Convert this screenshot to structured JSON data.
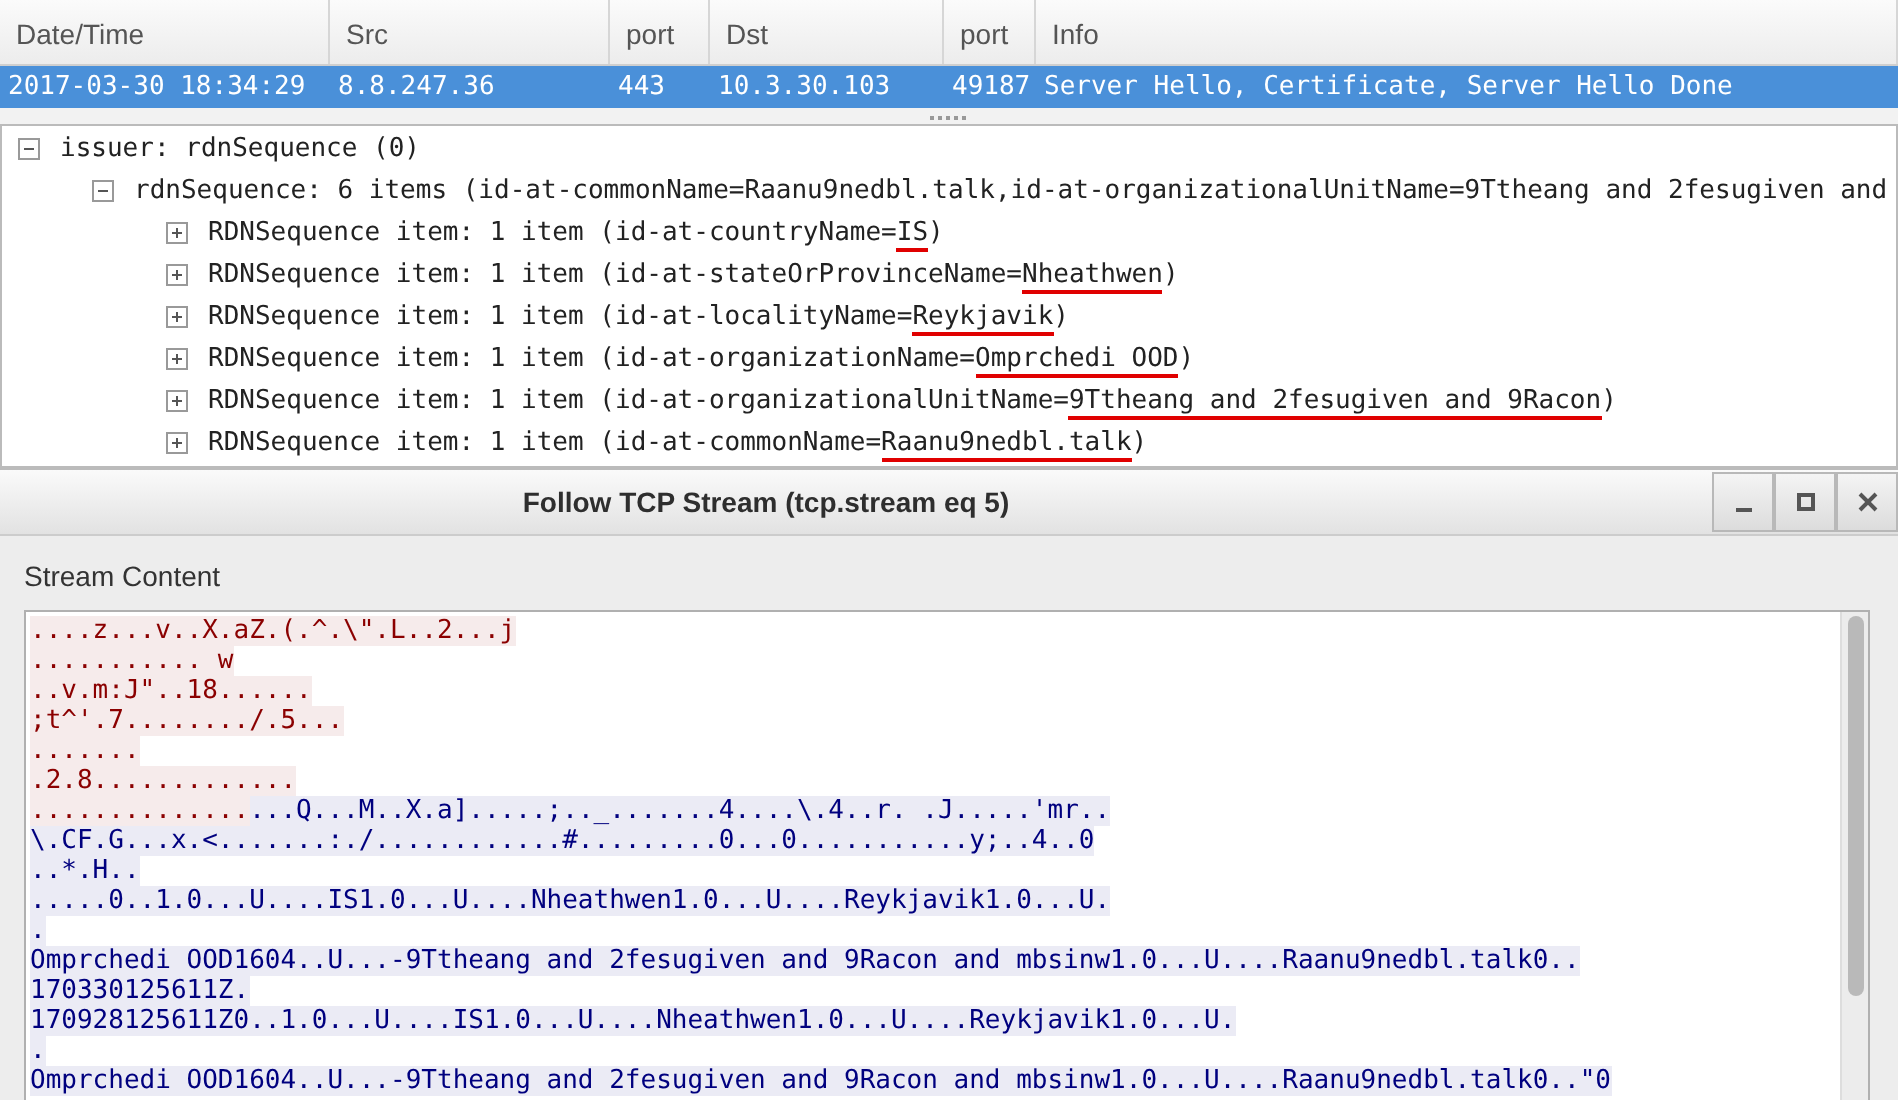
{
  "packet_list": {
    "columns": [
      "Date/Time",
      "Src",
      "port",
      "Dst",
      "port",
      "Info"
    ],
    "rows": [
      {
        "selected": true,
        "cells": [
          "2017-03-30 18:34:29",
          "8.8.247.36",
          "443",
          "10.3.30.103",
          "49187",
          "Server Hello, Certificate, Server Hello Done"
        ]
      }
    ]
  },
  "details": {
    "tree": [
      {
        "label": "issuer: rdnSequence (0)",
        "expanded": true,
        "children": [
          {
            "label": "rdnSequence: 6 items (id-at-commonName=Raanu9nedbl.talk,id-at-organizationalUnitName=9Ttheang and 2fesugiven and",
            "expanded": true,
            "children": [
              {
                "label": "RDNSequence item: 1 item (id-at-countryName=",
                "value": "IS",
                "label_end": ")",
                "underlined": true,
                "expanded": false
              },
              {
                "label": "RDNSequence item: 1 item (id-at-stateOrProvinceName=",
                "value": "Nheathwen",
                "label_end": ")",
                "underlined": true,
                "expanded": false
              },
              {
                "label": "RDNSequence item: 1 item (id-at-localityName=",
                "value": "Reykjavik",
                "label_end": ")",
                "underlined": true,
                "expanded": false
              },
              {
                "label": "RDNSequence item: 1 item (id-at-organizationName=",
                "value": "Omprchedi OOD",
                "label_end": ")",
                "underlined": true,
                "expanded": false
              },
              {
                "label": "RDNSequence item: 1 item (id-at-organizationalUnitName=",
                "value": "9Ttheang and 2fesugiven and 9Racon",
                "label_end": ")",
                "underlined": true,
                "expanded": false
              },
              {
                "label": "RDNSequence item: 1 item (id-at-commonName=",
                "value": "Raanu9nedbl.talk",
                "label_end": ")",
                "underlined": true,
                "expanded": false
              }
            ]
          }
        ]
      }
    ]
  },
  "dialog": {
    "title": "Follow TCP Stream (tcp.stream eq 5)",
    "stream_label": "Stream Content",
    "stream": [
      {
        "segments": [
          {
            "color": "#8b0000",
            "text": "....z...v..X.aZ.(.^.\\\".L..2...j"
          }
        ]
      },
      {
        "segments": [
          {
            "color": "#8b0000",
            "text": "........... w"
          }
        ]
      },
      {
        "segments": [
          {
            "color": "#8b0000",
            "text": "..v.m:J\"..18......"
          }
        ]
      },
      {
        "segments": [
          {
            "color": "#8b0000",
            "text": ";t^'.7......../.5..."
          }
        ]
      },
      {
        "segments": [
          {
            "color": "#8b0000",
            "text": "......."
          }
        ]
      },
      {
        "segments": [
          {
            "color": "#8b0000",
            "text": ".2.8............."
          }
        ]
      },
      {
        "segments": [
          {
            "color": "#8b0000",
            "text": ".............."
          },
          {
            "color": "#00007f",
            "text": "...Q...M..X.a].....;.._.......4....\\.4..r. .J.....'mr.."
          }
        ]
      },
      {
        "segments": [
          {
            "color": "#00007f",
            "text": "\\.CF.G...x.<.......:./............#.........0...0...........y;..4..0"
          }
        ]
      },
      {
        "segments": [
          {
            "color": "#00007f",
            "text": "..*.H.."
          }
        ]
      },
      {
        "segments": [
          {
            "color": "#00007f",
            "text": ".....0..1.0...U....IS1.0...U....Nheathwen1.0...U....Reykjavik1.0...U."
          }
        ]
      },
      {
        "segments": [
          {
            "color": "#00007f",
            "text": "."
          }
        ]
      },
      {
        "segments": [
          {
            "color": "#00007f",
            "text": "Omprchedi OOD1604..U...-9Ttheang and 2fesugiven and 9Racon and mbsinw1.0...U....Raanu9nedbl.talk0.."
          }
        ]
      },
      {
        "segments": [
          {
            "color": "#00007f",
            "text": "170330125611Z."
          }
        ]
      },
      {
        "segments": [
          {
            "color": "#00007f",
            "text": "170928125611Z0..1.0...U....IS1.0...U....Nheathwen1.0...U....Reykjavik1.0...U."
          }
        ]
      },
      {
        "segments": [
          {
            "color": "#00007f",
            "text": "."
          }
        ]
      },
      {
        "segments": [
          {
            "color": "#00007f",
            "text": "Omprchedi OOD1604..U...-9Ttheang and 2fesugiven and 9Racon and mbsinw1.0...U....Raanu9nedbl.talk0..\"0"
          }
        ]
      }
    ]
  }
}
